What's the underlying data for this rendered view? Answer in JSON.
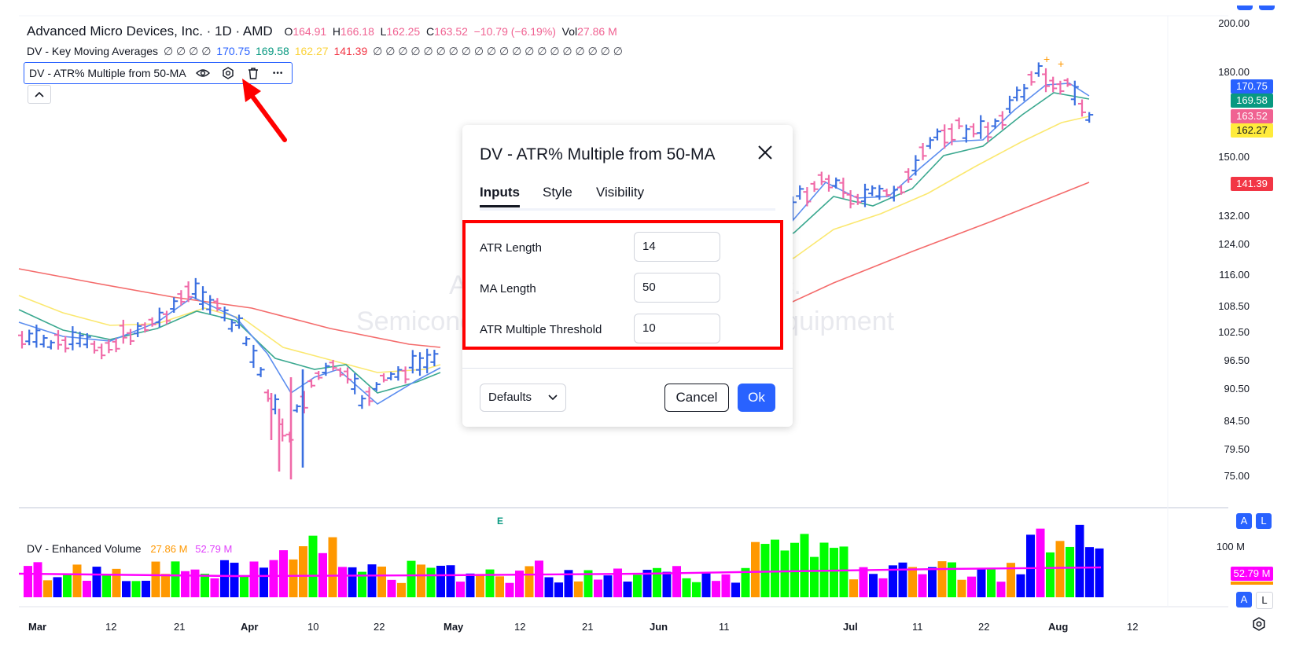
{
  "symbol_legend": {
    "name": "Advanced Micro Devices, Inc. · 1D · AMD",
    "o_label": "O",
    "o_val": "164.91",
    "h_label": "H",
    "h_val": "166.18",
    "l_label": "L",
    "l_val": "162.25",
    "c_label": "C",
    "c_val": "163.52",
    "change": "−10.79 (−6.19%)",
    "vol_label": "Vol",
    "vol_val": "27.86 M"
  },
  "ma_legend": {
    "name": "DV - Key Moving Averages",
    "empties": "∅ ∅ ∅ ∅",
    "v1": "170.75",
    "v2": "169.58",
    "v3": "162.27",
    "v4": "141.39",
    "empties2": "∅ ∅ ∅ ∅ ∅ ∅ ∅ ∅ ∅ ∅ ∅ ∅ ∅ ∅ ∅ ∅ ∅ ∅ ∅ ∅"
  },
  "indicator_legend": {
    "name": "DV - ATR% Multiple from 50-MA",
    "more": "•••"
  },
  "watermark": {
    "line1": "Advanced Micro Devices, Inc.",
    "line2": "Semiconductors & Semiconductor Equipment"
  },
  "price_axis": [
    "200.00",
    "180.00",
    "150.00",
    "132.00",
    "124.00",
    "116.00",
    "108.50",
    "102.50",
    "96.50",
    "90.50",
    "84.50",
    "79.50",
    "75.00"
  ],
  "price_tags": [
    {
      "text": "170.75",
      "color": "#2962ff"
    },
    {
      "text": "169.58",
      "color": "#089981"
    },
    {
      "text": "163.52",
      "color": "#f06292"
    },
    {
      "text": "162.27",
      "color": "#ffeb3b"
    },
    {
      "text": "141.39",
      "color": "#f23645"
    }
  ],
  "earnings_marker": "E",
  "volume_legend": {
    "name": "DV - Enhanced Volume",
    "v1": "27.86 M",
    "v2": "52.79 M"
  },
  "volume_axis": {
    "top": "100 M",
    "tag": "52.79 M"
  },
  "scale_buttons": {
    "auto": "A",
    "log": "L"
  },
  "time_axis": [
    "Mar",
    "12",
    "21",
    "Apr",
    "10",
    "22",
    "May",
    "12",
    "21",
    "Jun",
    "11",
    "Jul",
    "11",
    "22",
    "Aug",
    "12"
  ],
  "colors": {
    "up_bar": "#3a6fe0",
    "down_bar": "#f06aa8",
    "ma_blue": "#5b8def",
    "ma_teal": "#3aa88f",
    "ma_yellow": "#fbe870",
    "ma_red": "#f46b6b",
    "vol_blue": "#0000ff",
    "vol_green": "#00ff00",
    "vol_magenta": "#ff00ff",
    "vol_orange": "#ff9800"
  },
  "dialog": {
    "title": "DV - ATR% Multiple from 50-MA",
    "tabs": [
      "Inputs",
      "Style",
      "Visibility"
    ],
    "active_tab": "Inputs",
    "inputs": [
      {
        "label": "ATR Length",
        "value": "14"
      },
      {
        "label": "MA Length",
        "value": "50"
      },
      {
        "label": "ATR Multiple Threshold",
        "value": "10"
      }
    ],
    "defaults": "Defaults",
    "cancel": "Cancel",
    "ok": "Ok"
  }
}
